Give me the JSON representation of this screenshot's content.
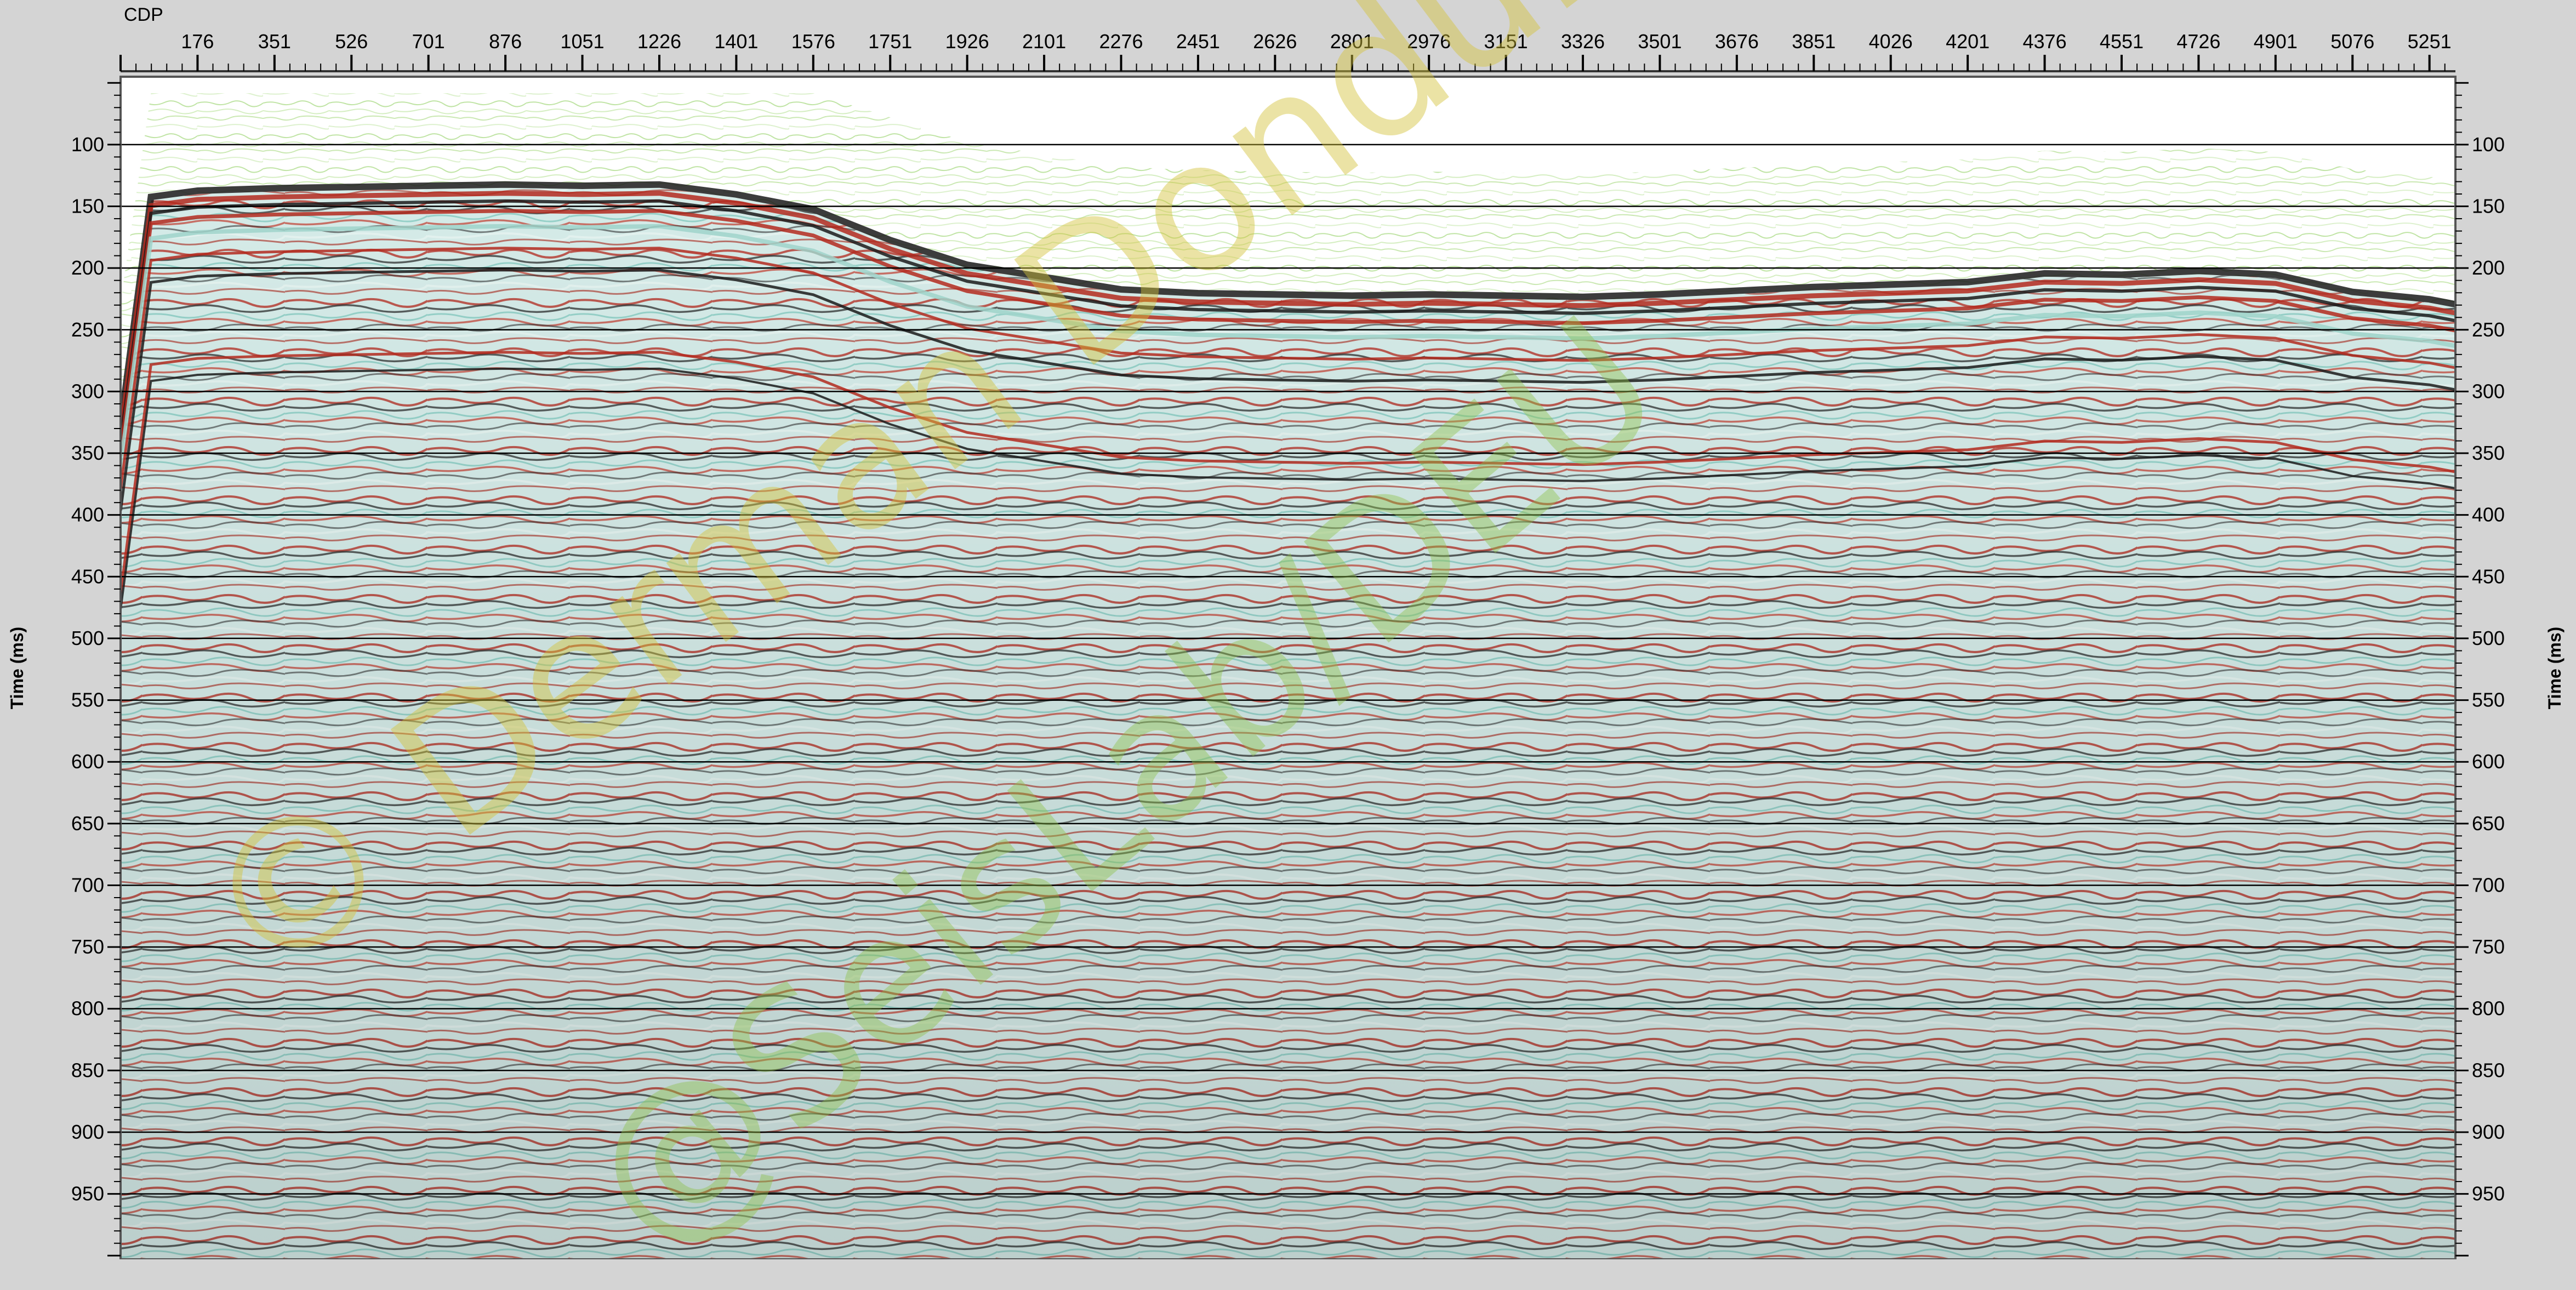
{
  "chart_data": {
    "type": "heatmap",
    "title": "",
    "xlabel": "CDP",
    "ylabel_left": "Time (ms)",
    "ylabel_right": "Time (ms)",
    "x_ticks": [
      1,
      176,
      351,
      526,
      701,
      876,
      1051,
      1226,
      1401,
      1576,
      1751,
      1926,
      2101,
      2276,
      2451,
      2626,
      2801,
      2976,
      3151,
      3326,
      3501,
      3676,
      3851,
      4026,
      4201,
      4376,
      4551,
      4726,
      4901,
      5076,
      5251
    ],
    "x_tick_labels": [
      "",
      "176",
      "351",
      "526",
      "701",
      "876",
      "1051",
      "1226",
      "1401",
      "1576",
      "1751",
      "1926",
      "2101",
      "2276",
      "2451",
      "2626",
      "2801",
      "2976",
      "3151",
      "3326",
      "3501",
      "3676",
      "3851",
      "4026",
      "4201",
      "4376",
      "4551",
      "4726",
      "4901",
      "5076",
      "5251"
    ],
    "xlim": [
      1,
      5310
    ],
    "y_ticks": [
      100,
      150,
      200,
      250,
      300,
      350,
      400,
      450,
      500,
      550,
      600,
      650,
      700,
      750,
      800,
      850,
      900,
      950
    ],
    "ylim": [
      45,
      1003
    ],
    "y_inverted": true,
    "grid": "horizontal",
    "seafloor": {
      "cdp": [
        1,
        70,
        176,
        351,
        526,
        701,
        876,
        1051,
        1226,
        1401,
        1576,
        1751,
        1926,
        2101,
        2276,
        2451,
        2626,
        2801,
        2976,
        3151,
        3326,
        3501,
        3676,
        3851,
        4026,
        4201,
        4376,
        4551,
        4726,
        4901,
        5076,
        5251,
        5310
      ],
      "time_ms": [
        330,
        145,
        140,
        138,
        137,
        136,
        135,
        136,
        135,
        143,
        155,
        180,
        200,
        210,
        220,
        223,
        224,
        225,
        224,
        225,
        226,
        224,
        221,
        218,
        216,
        214,
        207,
        208,
        205,
        208,
        222,
        228,
        232
      ]
    },
    "colors": {
      "peak": "#1a1a1a",
      "trough": "#b32a1e",
      "background": "#ffffff",
      "water_noise": "#a6d97f",
      "mid_tone": "#cfe9e6"
    }
  },
  "watermarks": {
    "line1": "© Derman Dondurur",
    "line2": "@SeisLab/DEU"
  }
}
